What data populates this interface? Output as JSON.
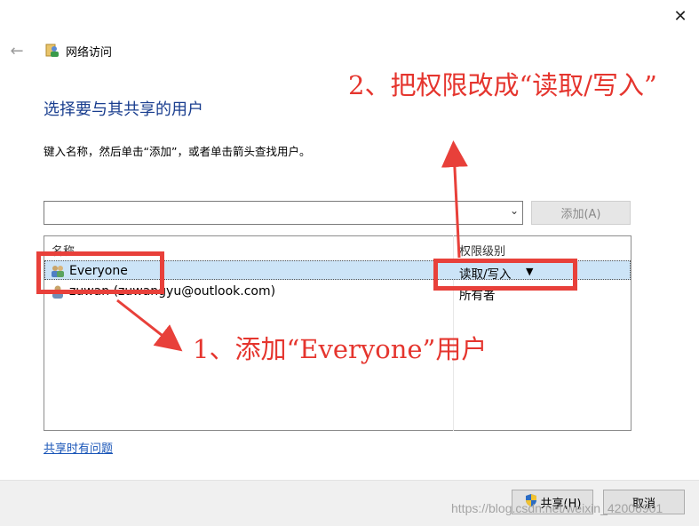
{
  "window": {
    "title": "网络访问",
    "close_glyph": "✕",
    "back_glyph": "←"
  },
  "main": {
    "heading": "选择要与其共享的用户",
    "instruction": "键入名称，然后单击“添加”，或者单击箭头查找用户。",
    "combo": {
      "value": "",
      "arrow_glyph": "⌄"
    },
    "add_button": "添加(A)"
  },
  "list": {
    "headers": {
      "name": "名称",
      "permission": "权限级别"
    },
    "rows": [
      {
        "name": "Everyone",
        "permission": "读取/写入",
        "dropdown_glyph": "▼",
        "selected": true
      },
      {
        "name": "zuwan (zuwangyu@outlook.com)",
        "permission": "所有者",
        "selected": false
      }
    ]
  },
  "help_link": "共享时有问题",
  "footer": {
    "share_button": "共享(H)",
    "cancel_button": "取消"
  },
  "annotations": {
    "note1": "1、添加“Everyone”用户",
    "note2": "2、把权限改成“读取/写入”",
    "color": "#e8403a"
  },
  "watermark": "https://blog.csdn.net/weixin_42006901",
  "colors": {
    "heading": "#1a3e8f",
    "link": "#1a56b8",
    "selection": "#cce4f7"
  }
}
